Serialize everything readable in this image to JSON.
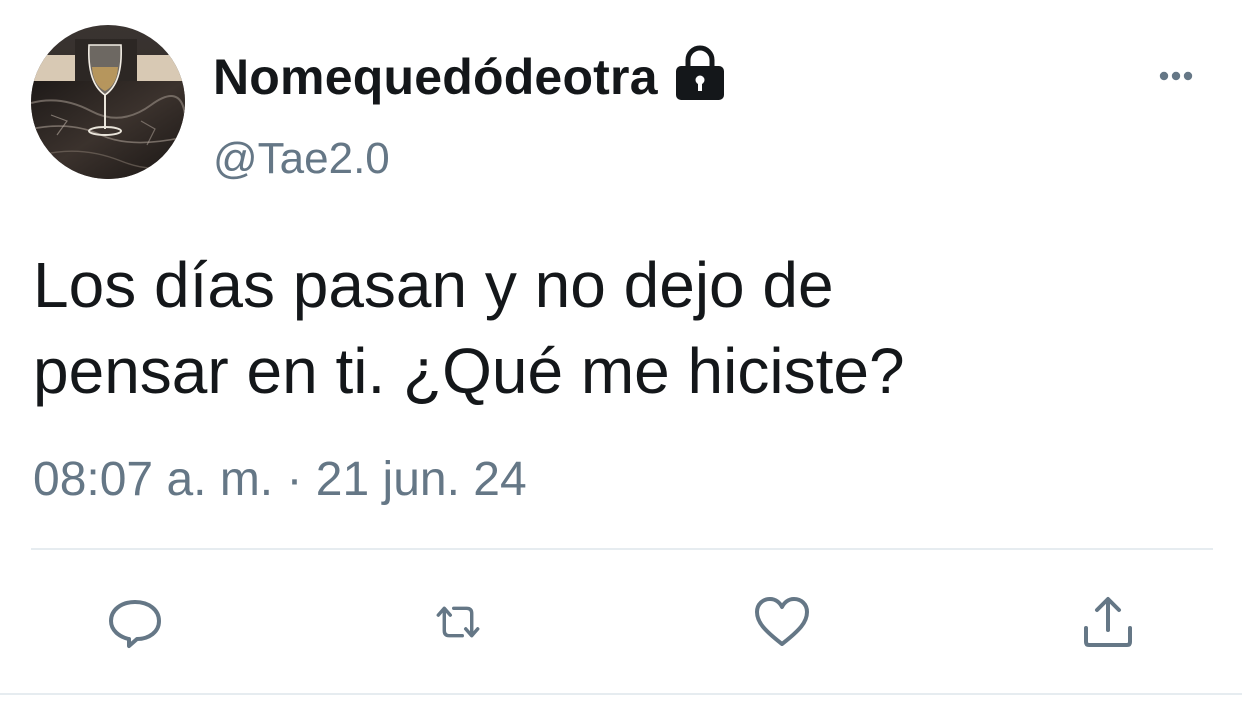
{
  "user": {
    "display_name": "Nomequedódeotra",
    "handle": "@Tae2.0",
    "avatar_icon": "wine-glass-avatar",
    "lock_icon": "lock-icon"
  },
  "tweet": {
    "text_line_1": "Los días pasan y no dejo de",
    "text_line_2": "pensar en ti. ¿Qué me hiciste?",
    "timestamp": "08:07 a. m. · 21 jun. 24"
  },
  "actions": {
    "reply_icon": "reply-icon",
    "retweet_icon": "retweet-icon",
    "like_icon": "heart-icon",
    "share_icon": "share-icon",
    "more_icon": "more-icon"
  },
  "colors": {
    "text": "#14171a",
    "secondary": "#657786",
    "divider": "#e6ecf0"
  }
}
